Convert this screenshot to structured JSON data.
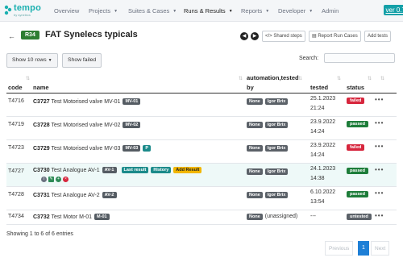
{
  "app": {
    "logo_text": "tempo",
    "logo_sub": "by synelecs",
    "version": "ver 0.7"
  },
  "nav": {
    "items": [
      "Overview",
      "Projects",
      "Suites & Cases",
      "Runs & Results",
      "Reports",
      "Developer",
      "Admin"
    ]
  },
  "run": {
    "badge": "R34",
    "title": "FAT Synelecs typicals",
    "toolbar": {
      "shared_steps": "Shared steps",
      "report_run_cases": "Report Run Cases",
      "add_tests": "Add tests"
    }
  },
  "controls": {
    "show_rows": "Show 10 rows",
    "show_failed": "Show failed",
    "search_label": "Search:",
    "search_value": ""
  },
  "table": {
    "headers": {
      "code": "code",
      "name": "name",
      "automation_line1": "automation,tested",
      "automation_line2": "by",
      "tested": "tested",
      "status": "status"
    },
    "rows": [
      {
        "code": "T4716",
        "case_id": "C3727",
        "name": "Test Motorised valve MV-01",
        "tag": "MV-01",
        "automation": "None",
        "tester": "Igor Brix",
        "date": "25.1.2023",
        "time": "21:24",
        "status": "failed"
      },
      {
        "code": "T4719",
        "case_id": "C3728",
        "name": "Test Motorised valve MV-02",
        "tag": "MV-02",
        "automation": "None",
        "tester": "Igor Brix",
        "date": "23.9.2022",
        "time": "14:24",
        "status": "passed"
      },
      {
        "code": "T4723",
        "case_id": "C3729",
        "name": "Test Motorised valve MV-03",
        "tag": "MV-03",
        "tag2": "P",
        "automation": "None",
        "tester": "Igor Brix",
        "date": "23.9.2022",
        "time": "14:24",
        "status": "failed"
      },
      {
        "code": "T4727",
        "case_id": "C3730",
        "name": "Test Analogue AV-1",
        "tag": "AV-1",
        "extra_tags": [
          "Last result",
          "History",
          "Add Result"
        ],
        "automation": "None",
        "tester": "Igor Brix",
        "date": "24.1.2023",
        "time": "14:38",
        "status": "passed"
      },
      {
        "code": "T4728",
        "case_id": "C3731",
        "name": "Test Analogue AV-2",
        "tag": "AV-2",
        "automation": "None",
        "tester": "Igor Brix",
        "date": "6.10.2022",
        "time": "13:54",
        "status": "passed"
      },
      {
        "code": "T4734",
        "case_id": "C3732",
        "name": "Test Motor M-01",
        "tag": "M-01",
        "automation": "None",
        "tester": "(unassigned)",
        "date": "---",
        "time": "",
        "status": "untested"
      }
    ]
  },
  "footer": {
    "info": "Showing 1 to 6 of 6 entries",
    "previous": "Previous",
    "page": "1",
    "next": "Next"
  },
  "colors": {
    "brand": "#14a0a8",
    "run_badge": "#2e7d32",
    "passed": "#1e7d3a",
    "failed": "#d7263d",
    "page_active": "#1e7fd6"
  }
}
